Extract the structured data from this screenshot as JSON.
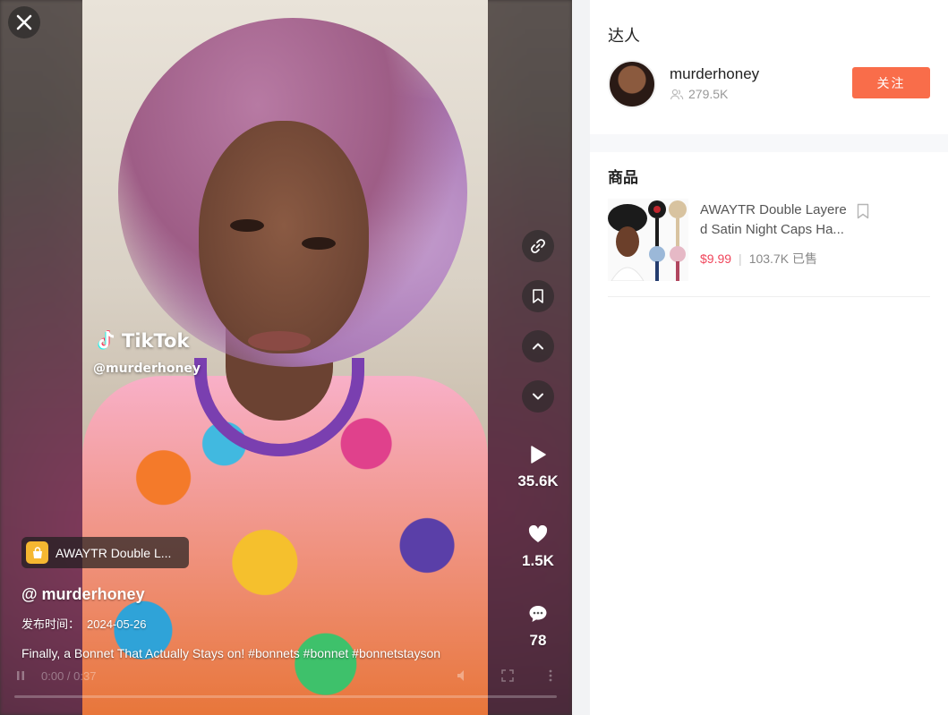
{
  "video": {
    "watermark_brand": "TikTok",
    "watermark_handle": "@murderhoney",
    "product_tag": "AWAYTR Double L...",
    "author": "@ murderhoney",
    "publish_label": "发布时间：",
    "publish_date": "2024-05-26",
    "caption": "Finally, a Bonnet That Actually Stays on! #bonnets #bonnet #bonnetstayson",
    "time_display": "0:00 / 0:37",
    "progress_fraction": 0.0,
    "stats": {
      "plays": "35.6K",
      "likes": "1.5K",
      "comments": "78"
    }
  },
  "panel": {
    "creator_section": "达人",
    "creator_name": "murderhoney",
    "creator_followers": "279.5K",
    "follow_label": "关注",
    "products_section": "商品",
    "product": {
      "name": "AWAYTR Double Layered Satin Night Caps Ha...",
      "price": "$9.99",
      "sold": "103.7K 已售"
    }
  },
  "colors": {
    "follow_button": "#f96d4a",
    "price": "#f0455b",
    "bag_icon": "#f5b731"
  }
}
